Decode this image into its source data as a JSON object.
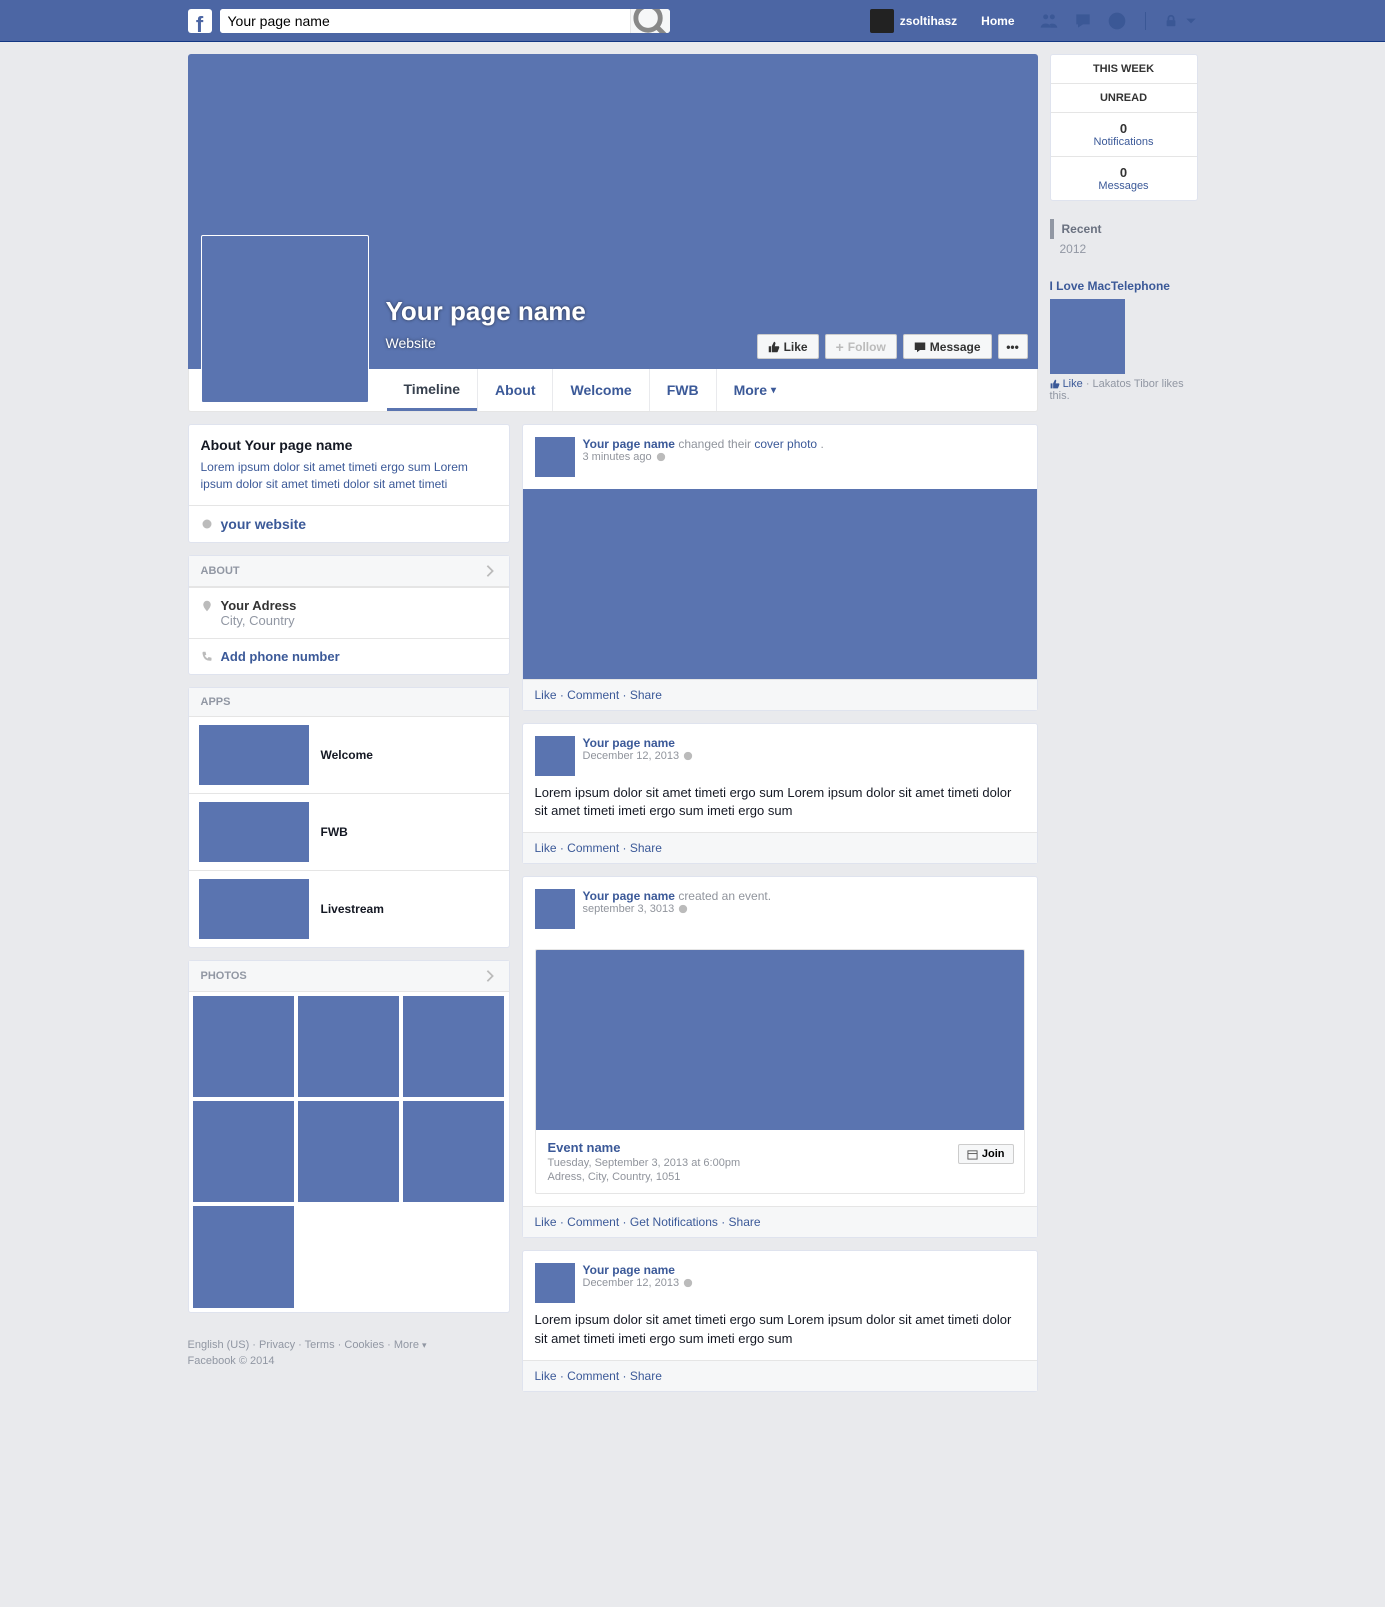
{
  "topbar": {
    "search_value": "Your page name",
    "username": "zsoltihasz",
    "home": "Home"
  },
  "cover": {
    "page_name": "Your page name",
    "category": "Website",
    "like_btn": "Like",
    "follow_btn": "Follow",
    "message_btn": "Message"
  },
  "tabs": [
    "Timeline",
    "About",
    "Welcome",
    "FWB",
    "More"
  ],
  "about_card": {
    "title": "About Your page name",
    "desc": "Lorem ipsum dolor sit amet timeti ergo sum Lorem ipsum dolor sit amet timeti dolor sit amet timeti",
    "website": "your website"
  },
  "about_section": {
    "header": "ABOUT",
    "address_line1": "Your Adress",
    "address_line2": "City, Country",
    "phone": "Add phone number"
  },
  "apps": {
    "header": "APPS",
    "items": [
      "Welcome",
      "FWB",
      "Livestream"
    ]
  },
  "photos": {
    "header": "PHOTOS"
  },
  "posts": [
    {
      "author": "Your page name",
      "action": " changed their ",
      "action_link": "cover photo",
      "action_suffix": ".",
      "time": "3 minutes ago",
      "has_image": true,
      "footer": "Like · Comment · Share"
    },
    {
      "author": "Your page name",
      "time": "December 12, 2013",
      "body": "Lorem ipsum dolor sit amet timeti ergo sum Lorem ipsum dolor sit amet timeti dolor sit amet timeti imeti ergo sum imeti ergo sum",
      "footer": "Like · Comment · Share"
    },
    {
      "author": "Your page name",
      "action": " created an event.",
      "time": "september 3, 3013",
      "event": {
        "name": "Event name",
        "line1": "Tuesday, September 3, 2013 at 6:00pm",
        "line2": "Adress, City, Country, 1051",
        "join": "Join"
      },
      "footer": "Like · Comment · Get Notifications · Share"
    },
    {
      "author": "Your page name",
      "time": "December 12, 2013",
      "body": "Lorem ipsum dolor sit amet timeti ergo sum Lorem ipsum dolor sit amet timeti dolor sit amet timeti imeti ergo sum imeti ergo sum",
      "footer": "Like · Comment · Share"
    }
  ],
  "right": {
    "this_week": "THIS WEEK",
    "unread": "UNREAD",
    "notif_num": "0",
    "notif_label": "Notifications",
    "msg_num": "0",
    "msg_label": "Messages",
    "recent": "Recent",
    "year": "2012",
    "related_title": "I Love MacTelephone",
    "related_like": "Like",
    "related_meta": " · Lakatos Tibor likes this."
  },
  "footer": {
    "links": "English (US) · Privacy · Terms · Cookies · More",
    "copyright": "Facebook © 2014"
  }
}
